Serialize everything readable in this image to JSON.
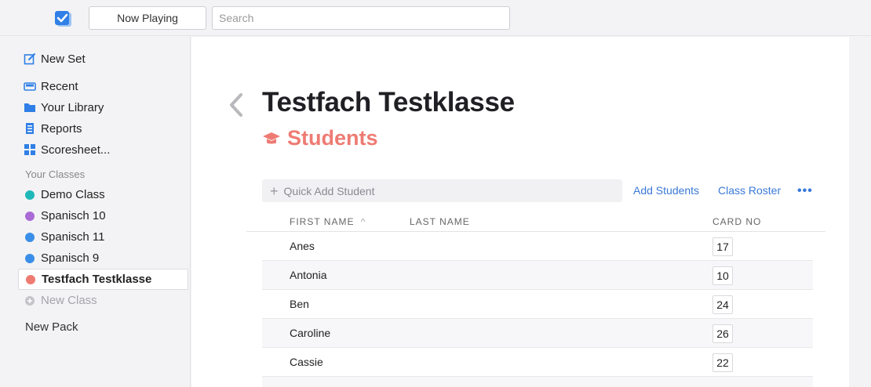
{
  "topbar": {
    "now_playing_label": "Now Playing",
    "search_placeholder": "Search"
  },
  "sidebar": {
    "new_set": "New Set",
    "nav": [
      {
        "label": "Recent",
        "icon": "inbox-icon"
      },
      {
        "label": "Your Library",
        "icon": "folder-icon"
      },
      {
        "label": "Reports",
        "icon": "report-icon"
      },
      {
        "label": "Scoresheet...",
        "icon": "grid-icon"
      }
    ],
    "classes_heading": "Your Classes",
    "classes": [
      {
        "label": "Demo Class",
        "color": "#1fb8b8"
      },
      {
        "label": "Spanisch 10",
        "color": "#a96ad6"
      },
      {
        "label": "Spanisch 11",
        "color": "#3b8ee8"
      },
      {
        "label": "Spanisch 9",
        "color": "#3b8ee8"
      },
      {
        "label": "Testfach Testklasse",
        "color": "#ee7b73"
      }
    ],
    "new_class": "New Class",
    "new_pack": "New Pack"
  },
  "main": {
    "title": "Testfach Testklasse",
    "subtitle": "Students",
    "quick_add_placeholder": "Quick Add Student",
    "add_students": "Add Students",
    "class_roster": "Class Roster",
    "more": "•••",
    "columns": {
      "first_name": "FIRST NAME",
      "sort_indicator": "^",
      "last_name": "LAST NAME",
      "card_no": "CARD NO"
    },
    "students": [
      {
        "first": "Anes",
        "card": "17"
      },
      {
        "first": "Antonia",
        "card": "10"
      },
      {
        "first": "Ben",
        "card": "24"
      },
      {
        "first": "Caroline",
        "card": "26"
      },
      {
        "first": "Cassie",
        "card": "22"
      }
    ]
  },
  "colors": {
    "accent": "#3a79d8",
    "title_accent": "#ee7b73"
  }
}
